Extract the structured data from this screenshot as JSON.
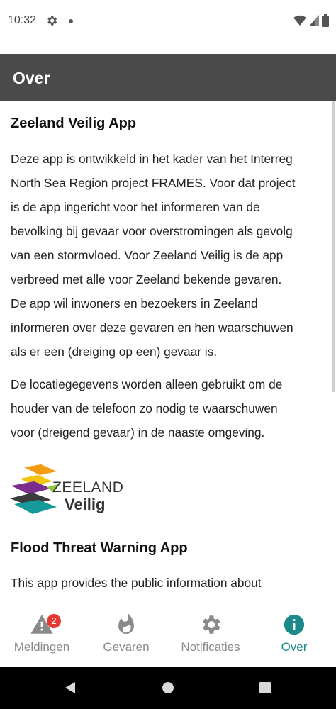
{
  "status_bar": {
    "time": "10:32"
  },
  "app_bar": {
    "title": "Over"
  },
  "content": {
    "section1": {
      "title": "Zeeland Veilig App",
      "paragraph1_lines": [
        "Deze app is ontwikkeld in het kader van het Interreg",
        "North Sea Region project FRAMES. Voor dat project",
        "is de app ingericht voor het informeren van de",
        "bevolking bij gevaar voor overstromingen als gevolg",
        "van een stormvloed. Voor Zeeland Veilig is de app",
        "verbreed met alle voor Zeeland bekende gevaren.",
        "De app wil inwoners en bezoekers in Zeeland",
        "informeren over deze gevaren en hen waarschuwen",
        "als er een (dreiging op een) gevaar is."
      ],
      "paragraph2_lines": [
        "De locatiegegevens worden alleen gebruikt om de",
        "houder van de telefoon zo nodig te waarschuwen",
        "voor (dreigend gevaar) in de naaste omgeving."
      ]
    },
    "logo": {
      "word1": "ZEELAND",
      "word2": "Veilig"
    },
    "section2": {
      "title": "Flood Threat Warning App",
      "paragraph1_lines": [
        "This app provides the public information about"
      ]
    }
  },
  "bottom_nav": {
    "items": [
      {
        "label": "Meldingen",
        "icon": "warning-icon",
        "badge": "2"
      },
      {
        "label": "Gevaren",
        "icon": "fire-icon"
      },
      {
        "label": "Notificaties",
        "icon": "gear-icon"
      },
      {
        "label": "Over",
        "icon": "info-icon"
      }
    ],
    "active_color": "#1a8a8a",
    "inactive_color": "#8a8a8a"
  },
  "colors": {
    "app_bar": "#4a4a4a",
    "badge": "#e53935"
  }
}
